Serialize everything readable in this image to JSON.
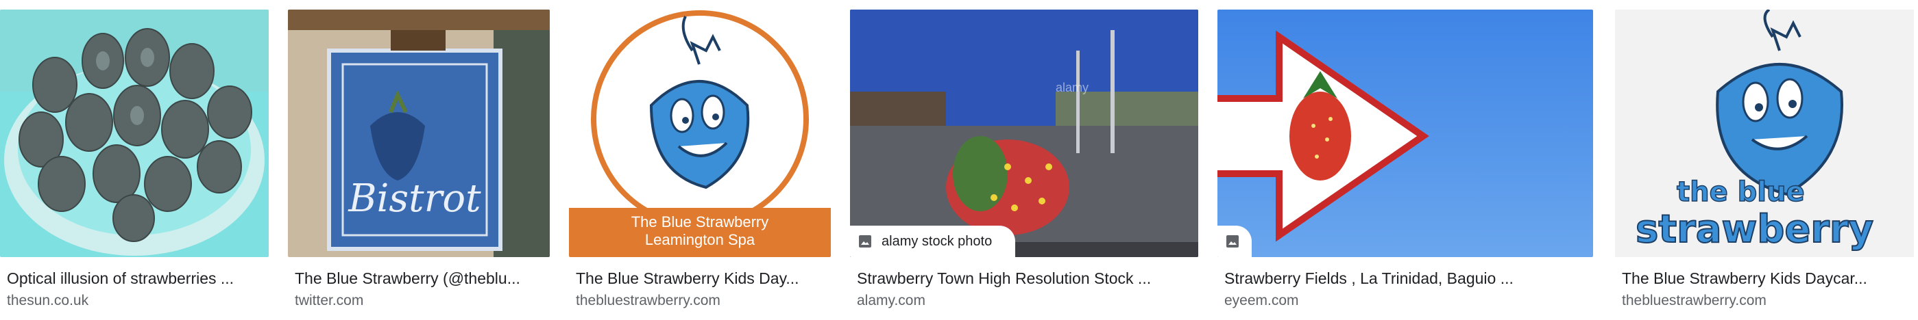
{
  "results": [
    {
      "title": "Optical illusion of strawberries ...",
      "source": "thesun.co.uk"
    },
    {
      "title": "The Blue Strawberry (@theblu...",
      "source": "twitter.com"
    },
    {
      "title": "The Blue Strawberry Kids Day...",
      "source": "thebluestrawberry.com",
      "image_caption_line1": "The Blue Strawberry",
      "image_caption_line2": "Leamington Spa"
    },
    {
      "title": "Strawberry Town High Resolution Stock ...",
      "source": "alamy.com",
      "watermark": "alamy stock photo",
      "watermark_small": "alamy"
    },
    {
      "title": "Strawberry Fields , La Trinidad, Baguio ...",
      "source": "eyeem.com"
    },
    {
      "title": "The Blue Strawberry Kids Daycar...",
      "source": "thebluestrawberry.com",
      "logo_text_line1": "the blue",
      "logo_text_line2": "strawberry"
    }
  ],
  "sign_text": "Bistrot",
  "colors": {
    "blue": "#3a8fd6",
    "orange": "#e07a2e",
    "title": "#202124",
    "source": "#5f6368"
  }
}
